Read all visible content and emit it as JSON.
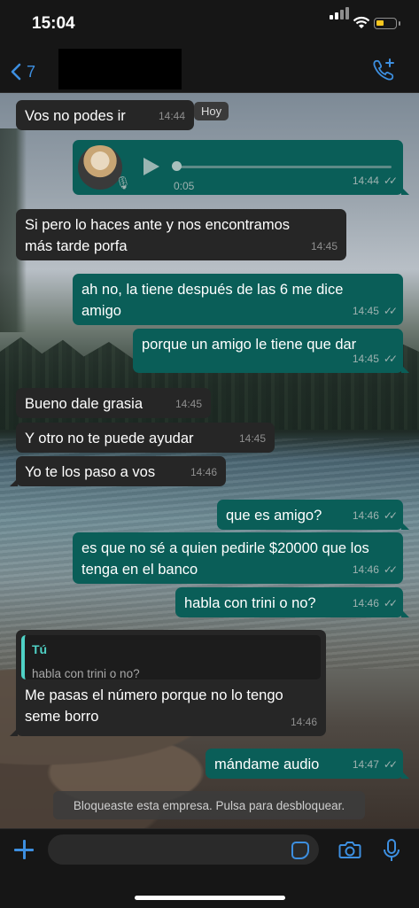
{
  "status": {
    "time": "15:04"
  },
  "header": {
    "back_count": "7"
  },
  "date_chip": "Hoy",
  "messages": [
    {
      "text": "Vos no podes ir",
      "time": "14:44"
    },
    {
      "audio_duration": "0:05",
      "time": "14:44"
    },
    {
      "text": "Si pero lo haces ante y nos encontramos más tarde porfa",
      "time": "14:45"
    },
    {
      "text": "ah no, la tiene después de las 6 me dice amigo",
      "time": "14:45"
    },
    {
      "text": "porque un amigo le tiene que dar",
      "time": "14:45"
    },
    {
      "text": "Bueno dale grasia",
      "time": "14:45"
    },
    {
      "text": "Y otro no te puede ayudar",
      "time": "14:45"
    },
    {
      "text": "Yo te los paso a vos",
      "time": "14:46"
    },
    {
      "text": "que es amigo?",
      "time": "14:46"
    },
    {
      "text": "es que no sé a quien pedirle $20000 que los tenga en el banco",
      "time": "14:46"
    },
    {
      "text": "habla con trini o no?",
      "time": "14:46"
    },
    {
      "quote_name": "Tú",
      "quote_text": "habla con trini o no?",
      "text": "Me pasas el número porque no lo tengo seme borro",
      "time": "14:46"
    },
    {
      "text": "mándame audio",
      "time": "14:47"
    }
  ],
  "blocked_notice": "Bloqueaste esta empresa. Pulsa para desbloquear.",
  "composer": {
    "placeholder": ""
  },
  "colors": {
    "outgoing": "#0a5e58",
    "incoming": "#262626",
    "accent": "#3d8fe0"
  }
}
